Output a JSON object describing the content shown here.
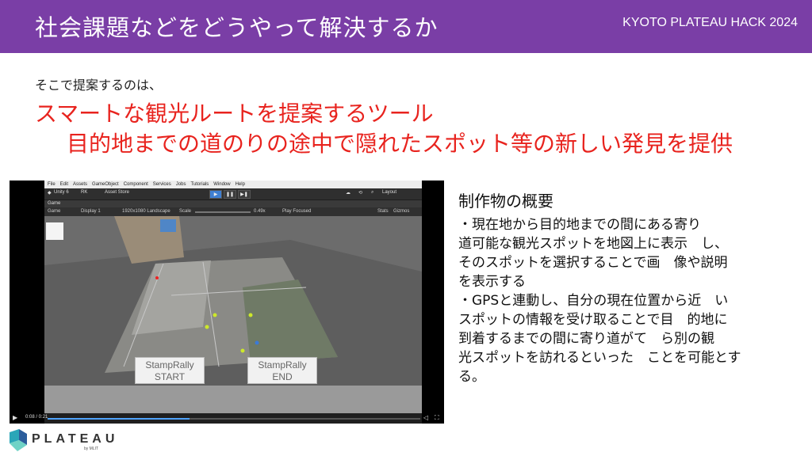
{
  "header": {
    "title": "社会課題などをどうやって解決するか",
    "event": "KYOTO PLATEAU HACK 2024",
    "color": "#7a3ea6"
  },
  "intro": "そこで提案するのは、",
  "proposal": {
    "line1": "スマートな観光ルートを提案するツール",
    "line2": "目的地までの道のりの途中で隠れたスポット等の新しい発見を提供",
    "color": "#e8231e"
  },
  "video": {
    "menu": [
      "File",
      "Edit",
      "Assets",
      "GameObject",
      "Component",
      "Services",
      "Jobs",
      "Tutorials",
      "Window",
      "Help"
    ],
    "toolbar": {
      "unity": "Unity 6",
      "account": "RK",
      "store": "Asset Store",
      "layout": "Layout"
    },
    "tab": "Game",
    "gamebar": {
      "mode": "Game",
      "display": "Display 1",
      "resolution": "1920x1080 Landscape",
      "scale_label": "Scale",
      "scale_value": "0.49x",
      "play": "Play Focused",
      "stats": "Stats",
      "gizmos": "Gizmos"
    },
    "buttons": {
      "start_line1": "StampRally",
      "start_line2": "START",
      "end_line1": "StampRally",
      "end_line2": "END"
    },
    "time": "0:08 / 0:21",
    "progress": 0.38
  },
  "summary": {
    "title": "制作物の概要",
    "lines": [
      "・現在地から目的地までの間にある寄り",
      "道可能な観光スポットを地図上に表示　し、",
      "そのスポットを選択することで画　像や説明",
      "を表示する",
      "・GPSと連動し、自分の現在位置から近　い",
      "スポットの情報を受け取ることで目　的地に",
      "到着するまでの間に寄り道がて　ら別の観",
      "光スポットを訪れるといった　ことを可能とす",
      "る。"
    ]
  },
  "logo": {
    "word": "PLATEAU",
    "by": "by MLIT"
  }
}
